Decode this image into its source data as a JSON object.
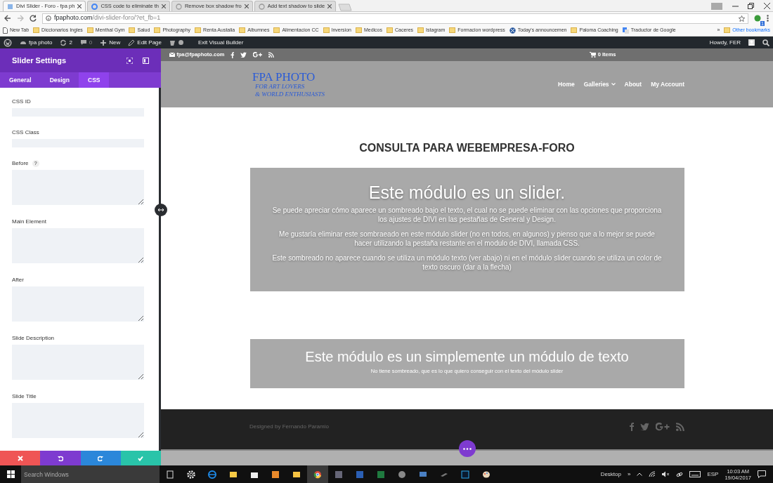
{
  "browser": {
    "tabs": [
      {
        "title": "Divi Slider - Foro - fpa ph",
        "selected": true,
        "kind": "site"
      },
      {
        "title": "CSS code to eliminate th",
        "selected": false,
        "kind": "google"
      },
      {
        "title": "Remove box shadow fro",
        "selected": false,
        "kind": "forum"
      },
      {
        "title": "Add text shadow to slide",
        "selected": false,
        "kind": "forum"
      }
    ],
    "url": {
      "host": "fpaphoto.com",
      "path": "/divi-slider-foro/?et_fb=1"
    },
    "bookmarks": [
      {
        "label": "New Tab",
        "kind": "page"
      },
      {
        "label": "Diccionarios Ingles",
        "kind": "folder"
      },
      {
        "label": "Menthal Gym",
        "kind": "folder"
      },
      {
        "label": "Salud",
        "kind": "folder"
      },
      {
        "label": "Photography",
        "kind": "folder"
      },
      {
        "label": "Renta Austalia",
        "kind": "folder"
      },
      {
        "label": "Albumnes",
        "kind": "folder"
      },
      {
        "label": "Alimentacion CC",
        "kind": "folder"
      },
      {
        "label": "Inversion",
        "kind": "folder"
      },
      {
        "label": "Medicos",
        "kind": "folder"
      },
      {
        "label": "Caceres",
        "kind": "folder"
      },
      {
        "label": "Istagram",
        "kind": "folder"
      },
      {
        "label": "Formacion wordpress",
        "kind": "folder"
      },
      {
        "label": "Today's announcemen",
        "kind": "site"
      },
      {
        "label": "Paloma Coaching",
        "kind": "folder"
      },
      {
        "label": "Traductor de Google",
        "kind": "translate"
      }
    ],
    "bookmarks_more": "»",
    "other_bookmarks": "Other bookmarks",
    "extension_badge": "1"
  },
  "admin_bar": {
    "items": [
      {
        "label": "fpa photo",
        "kind": "dashboard"
      },
      {
        "label": "2",
        "kind": "updates"
      },
      {
        "label": "0",
        "kind": "comments"
      },
      {
        "label": "New",
        "kind": "new"
      },
      {
        "label": "Edit Page",
        "kind": "edit"
      },
      {
        "kind": "yoast"
      },
      {
        "label": "Exit Visual Builder",
        "kind": "plain"
      }
    ],
    "greeting": "Howdy, FER"
  },
  "panel": {
    "title": "Slider Settings",
    "tabs": [
      {
        "label": "General",
        "selected": false
      },
      {
        "label": "Design",
        "selected": false
      },
      {
        "label": "CSS",
        "selected": true
      }
    ],
    "fields": [
      {
        "label": "CSS ID",
        "kind": "input"
      },
      {
        "label": "CSS Class",
        "kind": "input"
      },
      {
        "label": "Before",
        "kind": "textarea",
        "help": "?"
      },
      {
        "label": "Main Element",
        "kind": "textarea"
      },
      {
        "label": "After",
        "kind": "textarea"
      },
      {
        "label": "Slide Description",
        "kind": "textarea"
      },
      {
        "label": "Slide Title",
        "kind": "textarea"
      }
    ],
    "actions": [
      {
        "kind": "cancel"
      },
      {
        "kind": "undo"
      },
      {
        "kind": "redo"
      },
      {
        "kind": "save"
      }
    ]
  },
  "site": {
    "email": "fpa@fpaphoto.com",
    "cart": "0 Items",
    "logo": {
      "title": "FPA PHOTO",
      "tagline": [
        "FOR ART LOVERS",
        "& WORLD ENTHUSIASTS"
      ]
    },
    "nav": [
      {
        "label": "Home",
        "dropdown": false
      },
      {
        "label": "Galleries",
        "dropdown": true
      },
      {
        "label": "About",
        "dropdown": false
      },
      {
        "label": "My Account",
        "dropdown": false
      }
    ],
    "heading": "CONSULTA PARA WEBEMPRESA-FORO",
    "slider": {
      "title": "Este módulo es un slider.",
      "paragraphs": [
        "Se puede apreciar cómo aparece un sombreado bajo el texto, el cual no se puede eliminar con las opciones que proporciona los ajustes de DIVI en las pestañas de General y Design.",
        "Me gustaría eliminar este sombraeado en este módulo slider (no en todos, en algunos) y pienso que a lo mejor se puede hacer utilizando la pestaña restante en el modulo de DIVI, llamada CSS.",
        "Este sombreado no aparece cuando se utiliza un módulo texto (ver abajo) ni en el módulo slider cuando se utiliza un color de texto oscuro (dar a la flecha)"
      ]
    },
    "text_module": {
      "title": "Este módulo es un simplemente un módulo de texto",
      "text": "No tiene sombreado, que es lo que quiero conseguir con el texto del módulo slider"
    },
    "footer": "Designed by Fernando Paramio"
  },
  "taskbar": {
    "search_placeholder": "Search Windows",
    "toolbar": "Desktop",
    "toolbar_more": "»",
    "language": "ESP",
    "time": "10:03 AM",
    "date": "19/04/2017"
  }
}
